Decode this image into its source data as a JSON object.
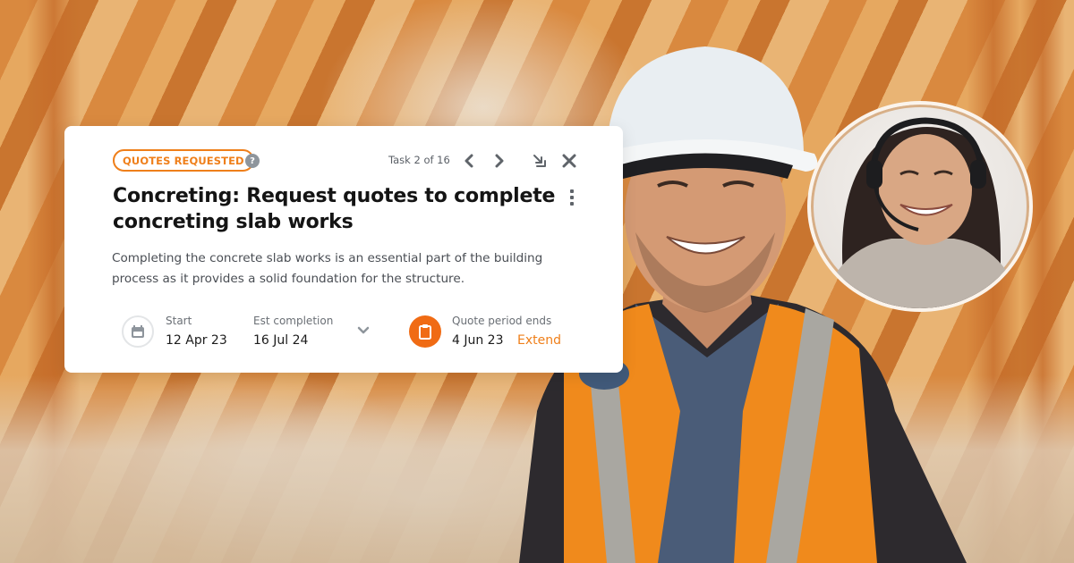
{
  "card": {
    "status_badge": "QUOTES REQUESTED",
    "help_icon": "?",
    "task_counter": "Task 2 of 16",
    "nav": {
      "previous_icon": "chevron-left-icon",
      "next_icon": "chevron-right-icon",
      "minimize_icon": "collapse-arrow-icon",
      "close_icon": "close-icon",
      "more_icon": "more-vertical-icon"
    },
    "title": "Concreting: Request quotes to complete concreting slab works",
    "description": "Completing the concrete slab works is an essential part of the building process as it provides a solid foundation for the structure.",
    "dates": {
      "start_label": "Start",
      "start_value": "12 Apr 23",
      "est_completion_label": "Est completion",
      "est_completion_value": "16 Jul 24",
      "quote_period_label": "Quote period ends",
      "quote_period_value": "4 Jun 23",
      "extend_label": "Extend"
    }
  },
  "colors": {
    "accent": "#ef7f1a",
    "accent_fill": "#f06b14",
    "icon_gray": "#8e959c",
    "title_text": "#141414",
    "body_text": "#4a4e54"
  },
  "images": {
    "worker": "smiling construction worker in white hard hat and hi-vis vest",
    "agent": "smiling support agent wearing headset"
  }
}
